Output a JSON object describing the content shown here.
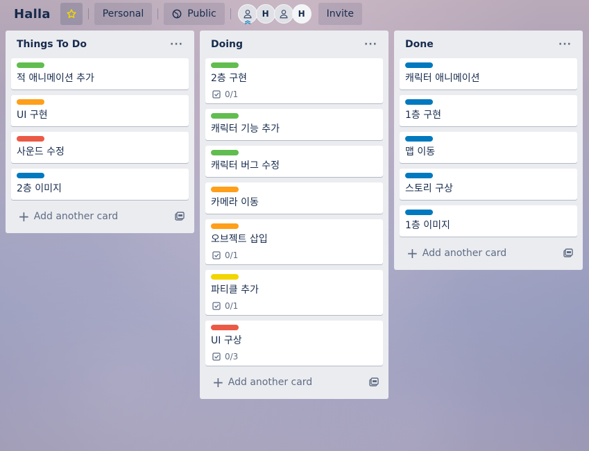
{
  "board": {
    "title": "Halla",
    "visibility_team": "Personal",
    "visibility": "Public",
    "invite_label": "Invite",
    "members": [
      "user",
      "H",
      "user",
      "H"
    ]
  },
  "colors": {
    "green": "#61bd4f",
    "orange": "#ff9f1a",
    "red": "#eb5a46",
    "blue": "#0079bf",
    "yellow": "#f2d600"
  },
  "add_card_label": "Add another card",
  "list_menu": "···",
  "lists": [
    {
      "title": "Things To Do",
      "cards": [
        {
          "label": "green",
          "title": "적 애니메이션 추가"
        },
        {
          "label": "orange",
          "title": "UI 구현"
        },
        {
          "label": "red",
          "title": "사운드 수정"
        },
        {
          "label": "blue",
          "title": "2층 이미지"
        }
      ]
    },
    {
      "title": "Doing",
      "cards": [
        {
          "label": "green",
          "title": "2층 구현",
          "checklist": "0/1"
        },
        {
          "label": "green",
          "title": "캐릭터 기능 추가"
        },
        {
          "label": "green",
          "title": "캐릭터 버그 수정"
        },
        {
          "label": "orange",
          "title": "카메라 이동"
        },
        {
          "label": "orange",
          "title": "오브젝트 삽입",
          "checklist": "0/1"
        },
        {
          "label": "yellow",
          "title": "파티클 추가",
          "checklist": "0/1"
        },
        {
          "label": "red",
          "title": "UI 구상",
          "checklist": "0/3"
        }
      ]
    },
    {
      "title": "Done",
      "cards": [
        {
          "label": "blue",
          "title": "캐릭터 애니메이션"
        },
        {
          "label": "blue",
          "title": "1층 구현"
        },
        {
          "label": "blue",
          "title": "맵 이동"
        },
        {
          "label": "blue",
          "title": "스토리 구상"
        },
        {
          "label": "blue",
          "title": "1층 이미지"
        }
      ]
    }
  ]
}
